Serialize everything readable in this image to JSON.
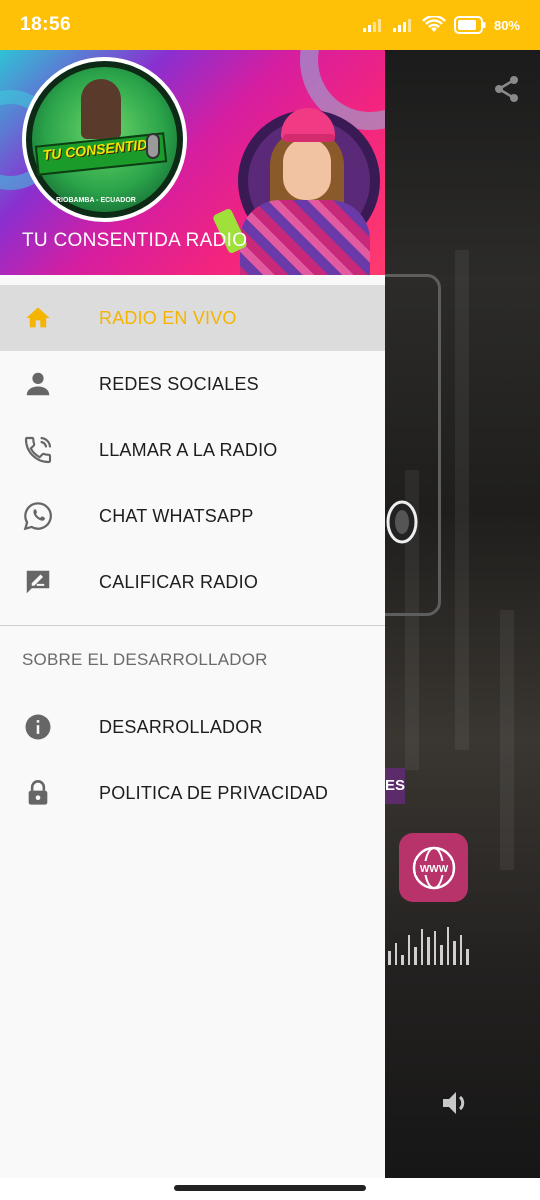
{
  "status_bar": {
    "time": "18:56",
    "battery": "80%",
    "icons": [
      "signal-icon",
      "signal-icon",
      "wifi-icon",
      "battery-icon"
    ]
  },
  "drawer": {
    "header_title": "TU CONSENTIDA RADIO",
    "logo": {
      "text": "TU CONSENTIDA",
      "subtext": "RIOBAMBA - ECUADOR"
    },
    "menu_items": [
      {
        "label": "RADIO EN VIVO",
        "icon": "home-icon",
        "active": true
      },
      {
        "label": "REDES SOCIALES",
        "icon": "person-icon"
      },
      {
        "label": "LLAMAR A LA RADIO",
        "icon": "phone-call-icon"
      },
      {
        "label": "CHAT WHATSAPP",
        "icon": "whatsapp-icon"
      },
      {
        "label": "CALIFICAR RADIO",
        "icon": "rate-review-icon"
      }
    ],
    "section_title": "SOBRE EL DESARROLLADOR",
    "developer_items": [
      {
        "label": "DESARROLLADOR",
        "icon": "info-icon"
      },
      {
        "label": "POLITICA DE PRIVACIDAD",
        "icon": "lock-icon"
      }
    ]
  },
  "background_app": {
    "visible_text": "ES",
    "www_label": "WWW"
  },
  "colors": {
    "status_bar": "#ffc107",
    "active_accent": "#f5b400",
    "active_bg": "#dcdcdc",
    "drawer_bg": "#f9f9f9"
  }
}
